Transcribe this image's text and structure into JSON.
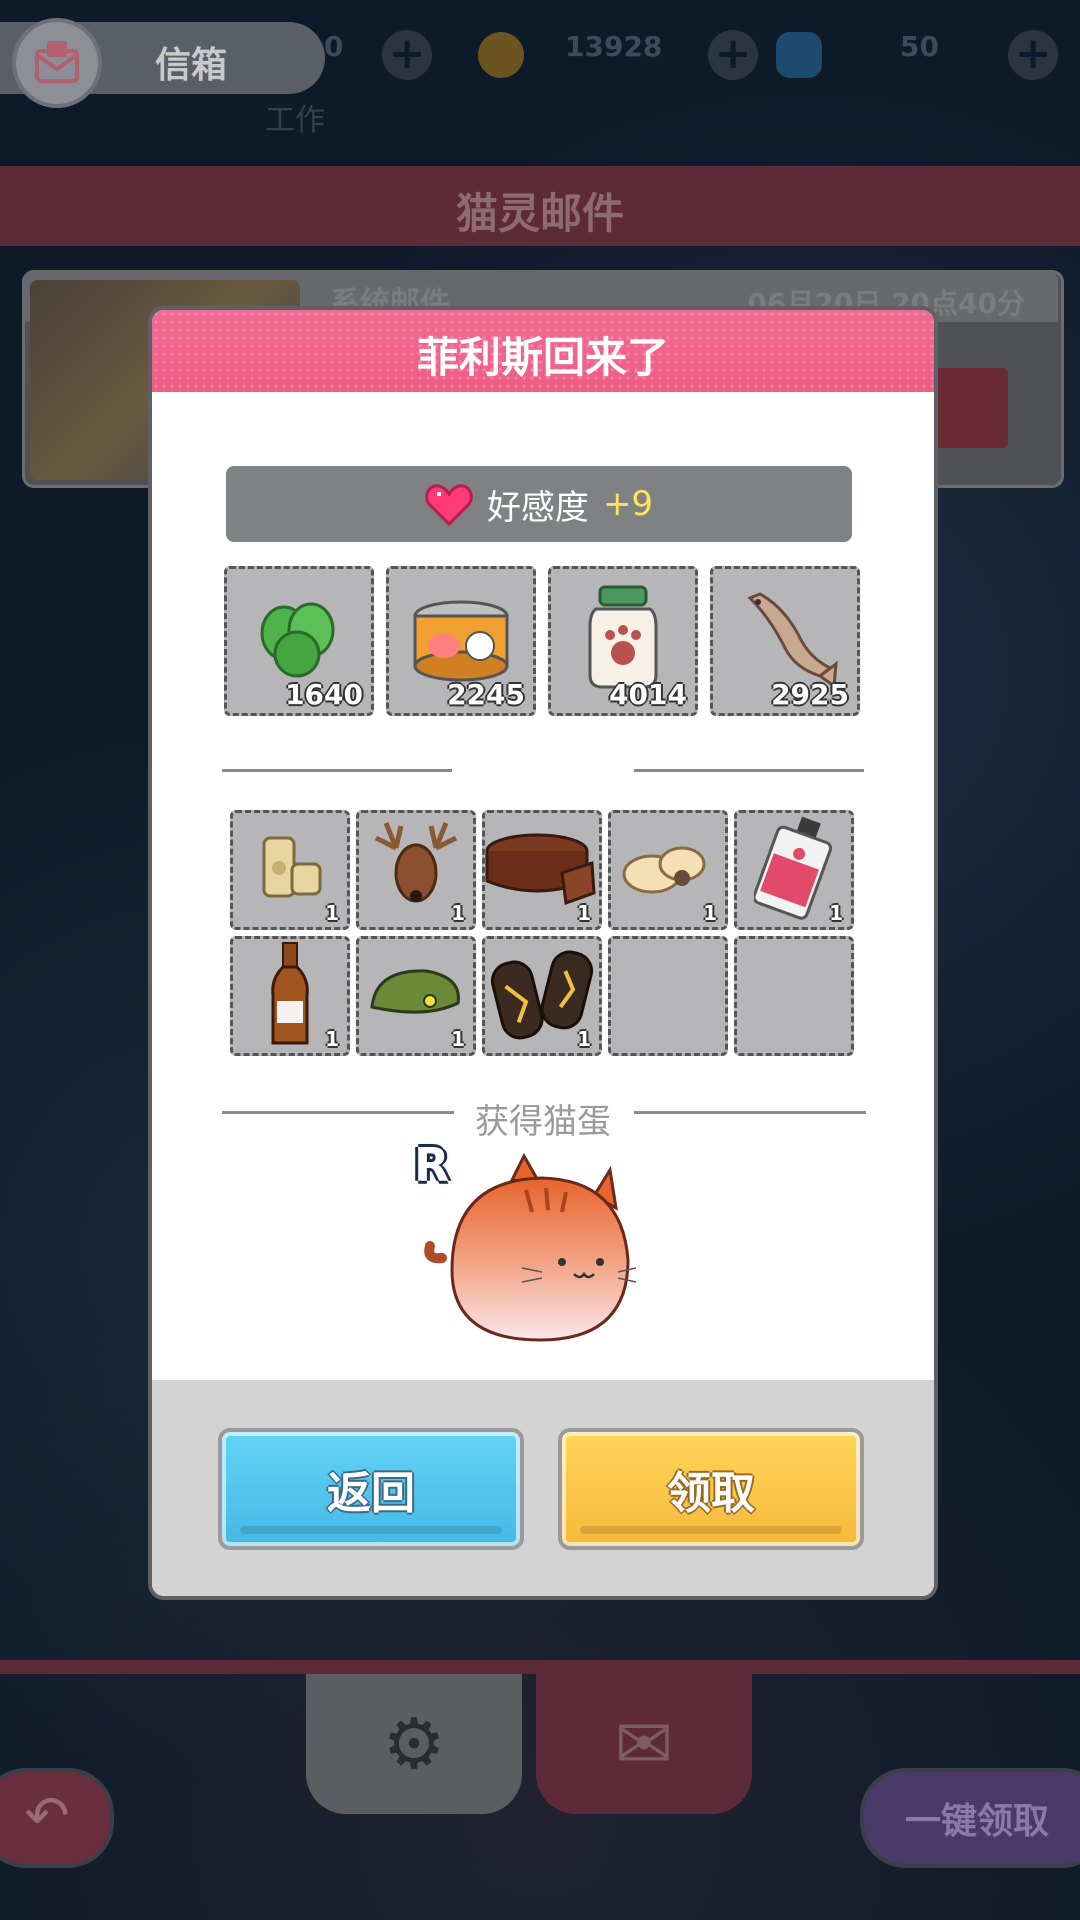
{
  "topbar": {
    "mail_title": "信箱",
    "resources": [
      "0",
      "13928",
      "50"
    ],
    "work_label": "工作"
  },
  "header": {
    "title": "猫灵邮件"
  },
  "background_mail": {
    "sender": "系统邮件",
    "date": "06月20日 20点40分"
  },
  "modal": {
    "title": "菲利斯回来了",
    "favor": {
      "label": "好感度",
      "value": "+9"
    },
    "resources": [
      {
        "icon": "catnip-icon",
        "count": "1640"
      },
      {
        "icon": "cat-food-can-icon",
        "count": "2245"
      },
      {
        "icon": "paw-jar-icon",
        "count": "4014"
      },
      {
        "icon": "dried-fish-icon",
        "count": "2925"
      }
    ],
    "items": [
      {
        "icon": "cork-icon",
        "count": "1"
      },
      {
        "icon": "deer-head-icon",
        "count": "1"
      },
      {
        "icon": "chocolate-cake-icon",
        "count": "1"
      },
      {
        "icon": "cookies-icon",
        "count": "1"
      },
      {
        "icon": "perfume-bottle-icon",
        "count": "1"
      },
      {
        "icon": "beer-bottle-icon",
        "count": "1"
      },
      {
        "icon": "beret-icon",
        "count": "1"
      },
      {
        "icon": "skateboard-icon",
        "count": "1"
      },
      {
        "icon": "empty-slot",
        "count": ""
      },
      {
        "icon": "empty-slot",
        "count": ""
      }
    ],
    "egg_label": "获得猫蛋",
    "egg_rank": "R",
    "buttons": {
      "back": "返回",
      "claim": "领取"
    }
  },
  "footer": {
    "claim_all": "一键领取"
  },
  "colors": {
    "header_pink": "#ef5c86",
    "back_blue": "#45b8e6",
    "claim_yellow": "#f6b93a",
    "favor_value": "#ffe35a"
  }
}
